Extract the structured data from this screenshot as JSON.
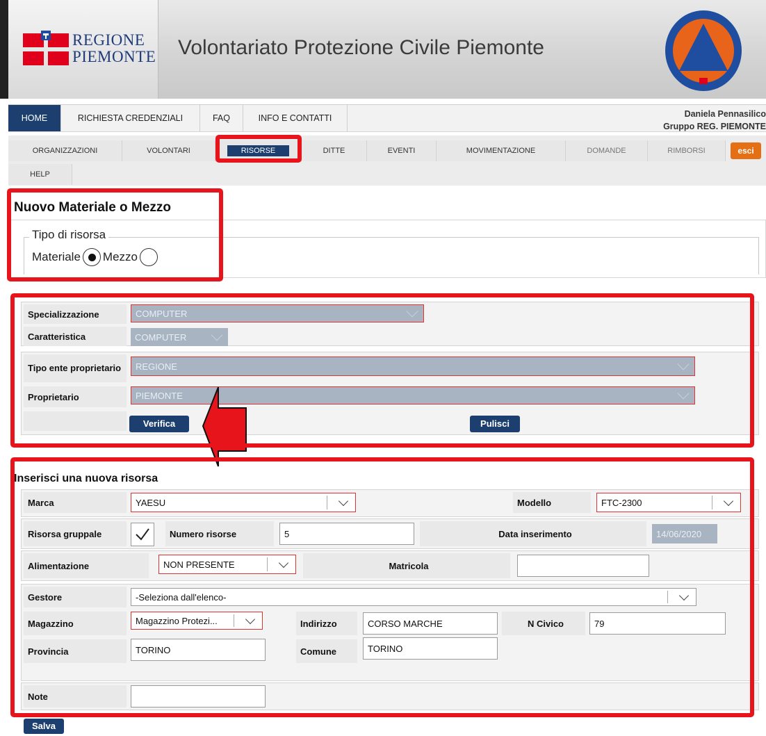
{
  "header": {
    "logo_line1": "REGIONE",
    "logo_line2": "PIEMONTE",
    "site_title": "Volontariato Protezione Civile Piemonte"
  },
  "topnav": {
    "items": [
      "HOME",
      "RICHIESTA CREDENZIALI",
      "FAQ",
      "INFO E CONTATTI"
    ],
    "active": "HOME",
    "user_name": "Daniela Pennasilico",
    "user_group": "Gruppo REG. PIEMONTE"
  },
  "subnav": {
    "items": [
      "ORGANIZZAZIONI",
      "VOLONTARI",
      "RISORSE",
      "DITTE",
      "EVENTI",
      "MOVIMENTAZIONE",
      "DOMANDE",
      "RIMBORSI",
      "HELP"
    ],
    "active": "RISORSE",
    "esci_label": "esci"
  },
  "new_resource": {
    "title": "Nuovo Materiale o Mezzo",
    "legend": "Tipo di risorsa",
    "option_materiale": "Materiale",
    "option_mezzo": "Mezzo",
    "selected": "Materiale"
  },
  "search_form": {
    "specializzazione_label": "Specializzazione",
    "specializzazione_value": "COMPUTER",
    "caratteristica_label": "Caratteristica",
    "caratteristica_value": "COMPUTER",
    "tipo_ente_label": "Tipo ente proprietario",
    "tipo_ente_value": "REGIONE",
    "proprietario_label": "Proprietario",
    "proprietario_value": "PIEMONTE",
    "verifica_label": "Verifica",
    "pulisci_label": "Pulisci"
  },
  "insert_form": {
    "title": "Inserisci una nuova risorsa",
    "marca_label": "Marca",
    "marca_value": "YAESU",
    "modello_label": "Modello",
    "modello_value": "FTC-2300",
    "risorsa_gruppale_label": "Risorsa gruppale",
    "risorsa_gruppale_checked": true,
    "numero_risorse_label": "Numero risorse",
    "numero_risorse_value": "5",
    "data_inserimento_label": "Data inserimento",
    "data_inserimento_value": "14/06/2020",
    "alimentazione_label": "Alimentazione",
    "alimentazione_value": "NON PRESENTE",
    "matricola_label": "Matricola",
    "matricola_value": "",
    "gestore_label": "Gestore",
    "gestore_value": "-Seleziona dall'elenco-",
    "magazzino_label": "Magazzino",
    "magazzino_value": "Magazzino Protezi...",
    "indirizzo_label": "Indirizzo",
    "indirizzo_value": "CORSO MARCHE",
    "n_civico_label": "N Civico",
    "n_civico_value": "79",
    "provincia_label": "Provincia",
    "provincia_value": "TORINO",
    "comune_label": "Comune",
    "comune_value": "TORINO",
    "note_label": "Note",
    "note_value": ""
  },
  "footer": {
    "salva_label": "Salva"
  },
  "colors": {
    "nav_active": "#1d3f70",
    "highlight": "#e8141b",
    "esci": "#e56f15",
    "disabled_select": "#a9b4c2"
  },
  "icons": [
    "regione-flag-icon",
    "protezione-civile-emblem",
    "chevron-down-icon",
    "checkbox-check-icon",
    "arrow-left-annotation"
  ]
}
